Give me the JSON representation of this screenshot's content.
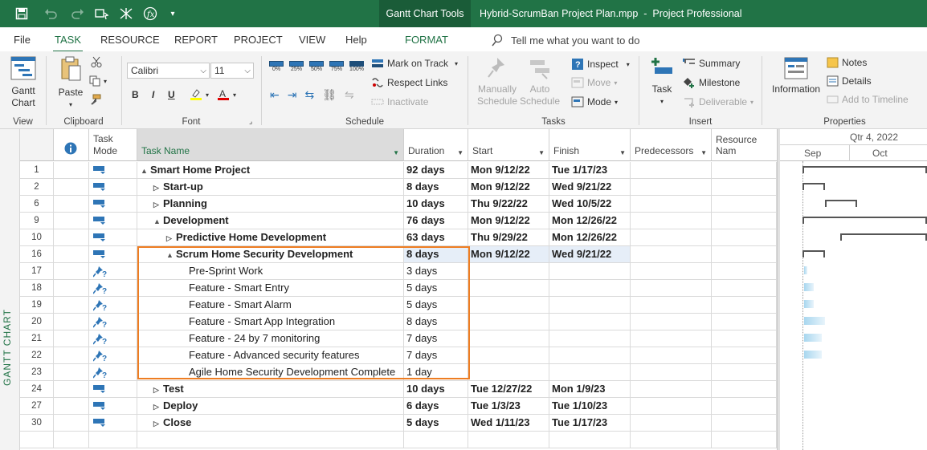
{
  "window": {
    "context_tab": "Gantt Chart Tools",
    "title": "Hybrid-ScrumBan Project Plan.mpp  -  Project Professional"
  },
  "ribbon_tabs": [
    {
      "label": "File"
    },
    {
      "label": "TASK",
      "active": true
    },
    {
      "label": "RESOURCE"
    },
    {
      "label": "REPORT"
    },
    {
      "label": "PROJECT"
    },
    {
      "label": "VIEW"
    },
    {
      "label": "Help"
    },
    {
      "label": "FORMAT"
    }
  ],
  "tell_me": "Tell me what you want to do",
  "ribbon": {
    "view": {
      "gantt_chart": "Gantt\nChart",
      "group": "View"
    },
    "clipboard": {
      "paste": "Paste",
      "group": "Clipboard"
    },
    "font": {
      "family": "Calibri",
      "size": "11",
      "bold": "B",
      "italic": "I",
      "underline": "U",
      "group": "Font"
    },
    "schedule": {
      "pct": [
        "0%",
        "25%",
        "50%",
        "75%",
        "100%"
      ],
      "mark_on_track": "Mark on Track",
      "respect_links": "Respect Links",
      "inactivate": "Inactivate",
      "group": "Schedule"
    },
    "tasks": {
      "manually_schedule": "Manually\nSchedule",
      "auto_schedule": "Auto\nSchedule",
      "inspect": "Inspect",
      "move": "Move",
      "mode": "Mode",
      "group": "Tasks"
    },
    "insert": {
      "task": "Task",
      "summary": "Summary",
      "milestone": "Milestone",
      "deliverable": "Deliverable",
      "group": "Insert"
    },
    "properties": {
      "information": "Information",
      "notes": "Notes",
      "details": "Details",
      "add_to_timeline": "Add to Timeline",
      "group": "Properties"
    }
  },
  "view_bar_label": "GANTT CHART",
  "columns": {
    "task_mode": "Task\nMode",
    "task_name": "Task Name",
    "duration": "Duration",
    "start": "Start",
    "finish": "Finish",
    "predecessors": "Predecessors",
    "resource_names": "Resource Nam"
  },
  "timescale": {
    "quarter": "Qtr 4, 2022",
    "months": [
      "Sep",
      "Oct"
    ]
  },
  "tasks": [
    {
      "id": "1",
      "name": "Smart Home Project",
      "level": 0,
      "expander": "▲",
      "bold": true,
      "mode": "auto",
      "duration": "92 days",
      "start": "Mon 9/12/22",
      "finish": "Tue 1/17/23"
    },
    {
      "id": "2",
      "name": "Start-up",
      "level": 1,
      "expander": "▷",
      "bold": true,
      "mode": "auto",
      "duration": "8 days",
      "start": "Mon 9/12/22",
      "finish": "Wed 9/21/22"
    },
    {
      "id": "6",
      "name": "Planning",
      "level": 1,
      "expander": "▷",
      "bold": true,
      "mode": "auto",
      "duration": "10 days",
      "start": "Thu 9/22/22",
      "finish": "Wed 10/5/22"
    },
    {
      "id": "9",
      "name": "Development",
      "level": 1,
      "expander": "▲",
      "bold": true,
      "mode": "auto",
      "duration": "76 days",
      "start": "Mon 9/12/22",
      "finish": "Mon 12/26/22"
    },
    {
      "id": "10",
      "name": "Predictive Home Development",
      "level": 2,
      "expander": "▷",
      "bold": true,
      "mode": "auto",
      "duration": "63 days",
      "start": "Thu 9/29/22",
      "finish": "Mon 12/26/22"
    },
    {
      "id": "16",
      "name": "Scrum Home Security Development",
      "level": 2,
      "expander": "▲",
      "bold": true,
      "mode": "auto",
      "duration": "8 days",
      "start": "Mon 9/12/22",
      "finish": "Wed 9/21/22",
      "selected": true
    },
    {
      "id": "17",
      "name": "Pre-Sprint Work",
      "level": 3,
      "expander": "",
      "bold": false,
      "mode": "manual",
      "duration": "3 days",
      "start": "",
      "finish": ""
    },
    {
      "id": "18",
      "name": "Feature - Smart Entry",
      "level": 3,
      "expander": "",
      "bold": false,
      "mode": "manual",
      "duration": "5 days",
      "start": "",
      "finish": ""
    },
    {
      "id": "19",
      "name": "Feature - Smart Alarm",
      "level": 3,
      "expander": "",
      "bold": false,
      "mode": "manual",
      "duration": "5 days",
      "start": "",
      "finish": ""
    },
    {
      "id": "20",
      "name": "Feature - Smart App Integration",
      "level": 3,
      "expander": "",
      "bold": false,
      "mode": "manual",
      "duration": "8 days",
      "start": "",
      "finish": ""
    },
    {
      "id": "21",
      "name": "Feature - 24 by 7 monitoring",
      "level": 3,
      "expander": "",
      "bold": false,
      "mode": "manual",
      "duration": "7 days",
      "start": "",
      "finish": ""
    },
    {
      "id": "22",
      "name": "Feature - Advanced security features",
      "level": 3,
      "expander": "",
      "bold": false,
      "mode": "manual",
      "duration": "7 days",
      "start": "",
      "finish": ""
    },
    {
      "id": "23",
      "name": "Agile Home Security Development Complete",
      "level": 3,
      "expander": "",
      "bold": false,
      "mode": "manual",
      "duration": "1 day",
      "start": "",
      "finish": ""
    },
    {
      "id": "24",
      "name": "Test",
      "level": 1,
      "expander": "▷",
      "bold": true,
      "mode": "auto",
      "duration": "10 days",
      "start": "Tue 12/27/22",
      "finish": "Mon 1/9/23"
    },
    {
      "id": "27",
      "name": "Deploy",
      "level": 1,
      "expander": "▷",
      "bold": true,
      "mode": "auto",
      "duration": "6 days",
      "start": "Tue 1/3/23",
      "finish": "Tue 1/10/23"
    },
    {
      "id": "30",
      "name": "Close",
      "level": 1,
      "expander": "▷",
      "bold": true,
      "mode": "auto",
      "duration": "5 days",
      "start": "Wed 1/11/23",
      "finish": "Tue 1/17/23"
    }
  ],
  "colors": {
    "accent": "#217346",
    "highlight": "#ee7d22",
    "selected_cell": "#e6eef8",
    "manual_bar": "#a9d7ef"
  }
}
